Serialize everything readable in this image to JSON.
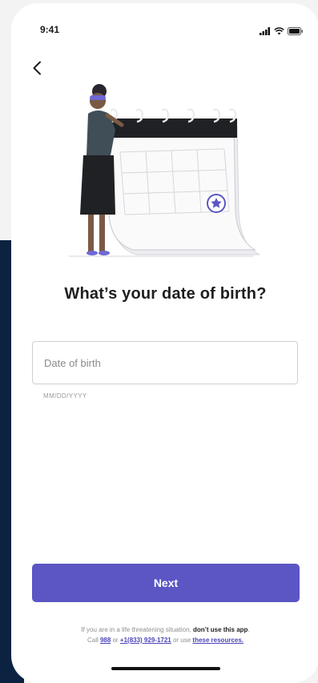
{
  "status_bar": {
    "time": "9:41"
  },
  "icons": {
    "back": "chevron-left-icon",
    "signal": "signal-icon",
    "wifi": "wifi-icon",
    "battery": "battery-icon"
  },
  "illustration": {
    "name": "woman-leaning-on-calendar"
  },
  "heading": "What’s your date of birth?",
  "dob_field": {
    "placeholder": "Date of birth",
    "value": "",
    "helper": "MM/DD/YYYY"
  },
  "next_button": {
    "label": "Next"
  },
  "disclaimer": {
    "line1_prefix": "If you are in a life threatening situation, ",
    "line1_bold": "don’t use this app",
    "line1_suffix": ".",
    "line2_prefix": "Call ",
    "phone1": "988",
    "line2_or": " or ",
    "phone2": "+1(833) 929-1721",
    "line2_mid": " or use ",
    "resources_link": "these resources."
  },
  "colors": {
    "accent": "#5b56c4",
    "navy": "#0b2340",
    "link": "#4a45b8"
  }
}
